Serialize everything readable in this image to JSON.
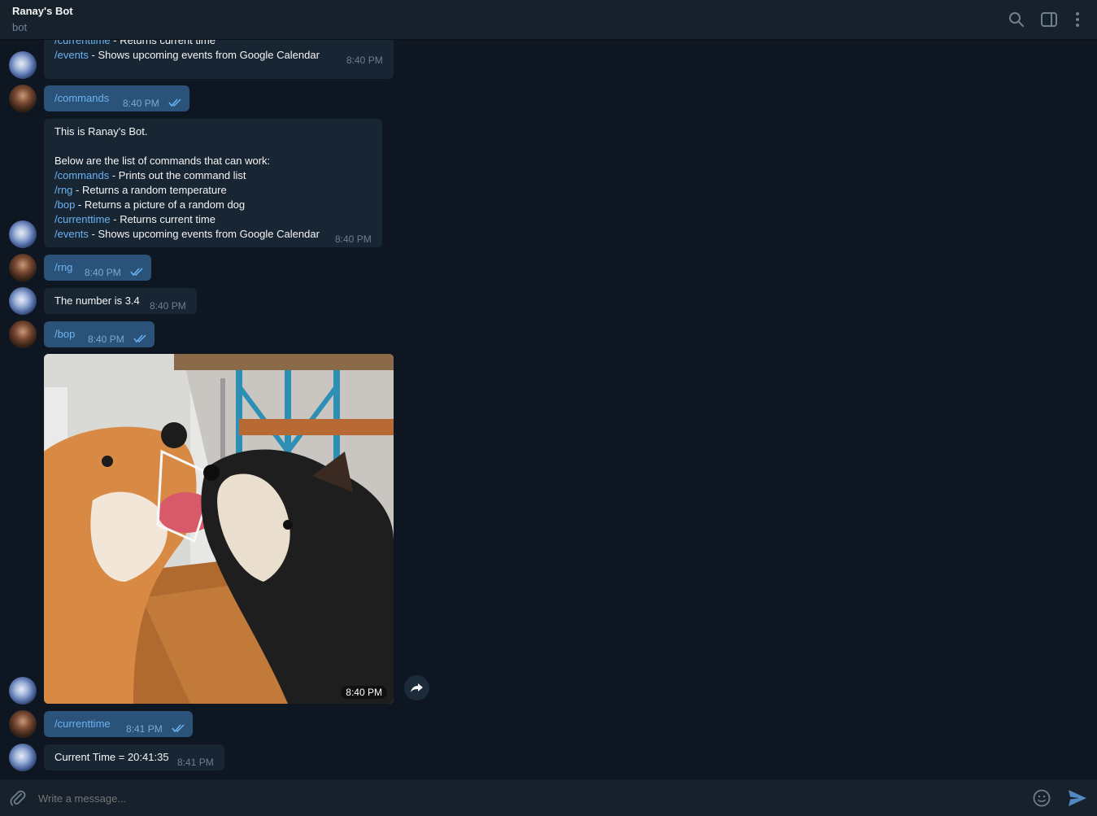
{
  "header": {
    "title": "Ranay's Bot",
    "subtitle": "bot"
  },
  "messages": {
    "m1": {
      "line_current_cmd": "/currenttime",
      "line_current_desc": " - Returns current time",
      "line_events_cmd": "/events",
      "line_events_desc": " - Shows upcoming events from Google Calendar",
      "time": "8:40 PM"
    },
    "m2": {
      "text": "/commands",
      "time": "8:40 PM"
    },
    "m3": {
      "intro": "This is Ranay's Bot.",
      "list_intro": "Below are the list of commands that can work:",
      "commands": [
        {
          "cmd": "/commands",
          "desc": " - Prints out the command list"
        },
        {
          "cmd": "/rng",
          "desc": " - Returns a random temperature"
        },
        {
          "cmd": "/bop",
          "desc": " - Returns a picture of a random dog"
        },
        {
          "cmd": "/currenttime",
          "desc": " - Returns current time"
        },
        {
          "cmd": "/events",
          "desc": " - Shows upcoming events from Google Calendar"
        }
      ],
      "time": "8:40 PM"
    },
    "m4": {
      "text": "/rng",
      "time": "8:40 PM"
    },
    "m5": {
      "text": "The number is 3.4",
      "time": "8:40 PM"
    },
    "m6": {
      "text": "/bop",
      "time": "8:40 PM"
    },
    "m7": {
      "time": "8:40 PM"
    },
    "m8": {
      "text": "/currenttime",
      "time": "8:41 PM"
    },
    "m9": {
      "text": "Current Time = 20:41:35",
      "time": "8:41 PM"
    }
  },
  "composer": {
    "placeholder": "Write a message..."
  },
  "colors": {
    "background": "#0e1621",
    "panel": "#17212b",
    "incoming": "#182533",
    "outgoing": "#2b5278",
    "link": "#6ab3f3"
  },
  "icons": [
    "search-icon",
    "sidebar-toggle-icon",
    "more-vertical-icon",
    "attach-icon",
    "emoji-icon",
    "send-icon",
    "share-icon",
    "double-check-icon"
  ]
}
